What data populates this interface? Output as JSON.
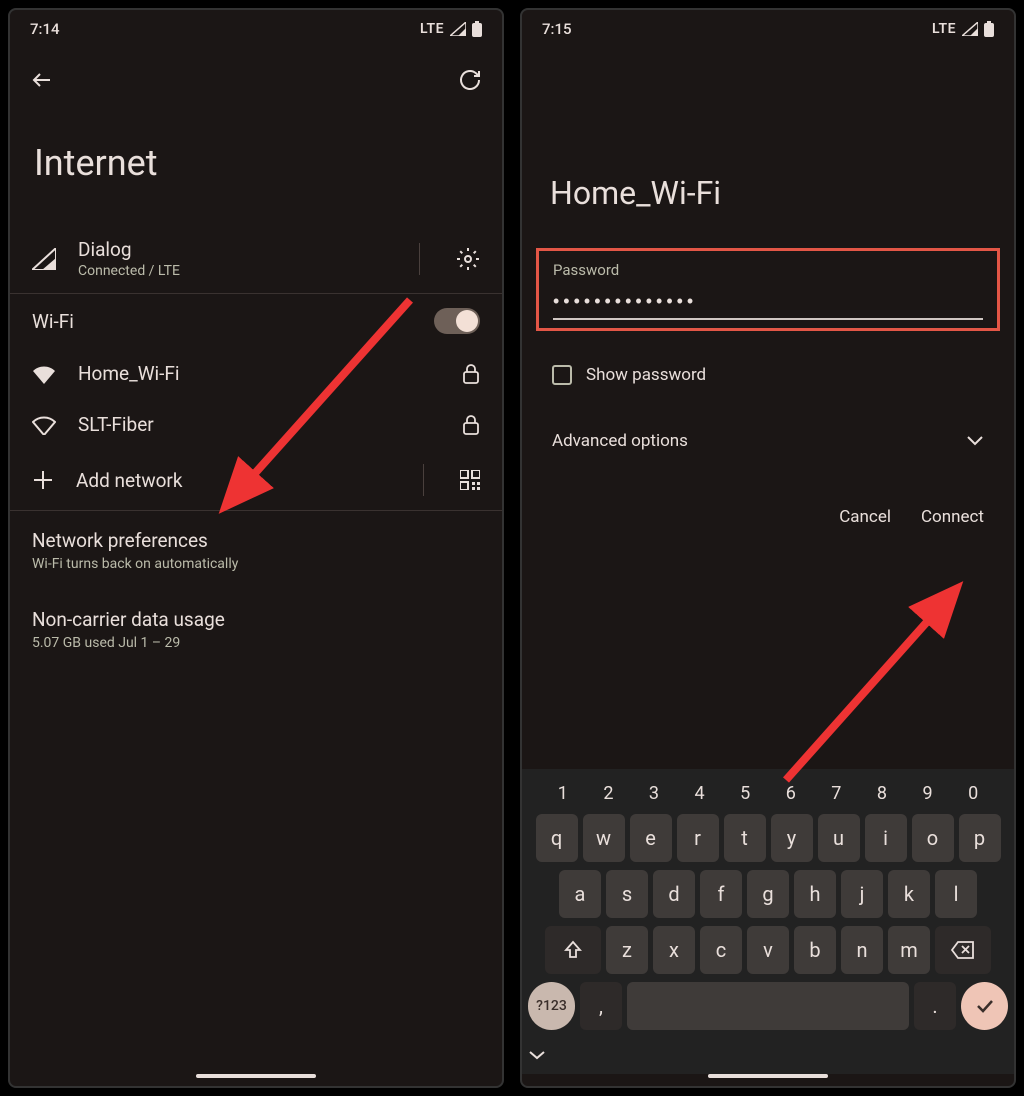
{
  "left": {
    "status": {
      "time": "7:14",
      "net": "LTE"
    },
    "page_title": "Internet",
    "carrier": {
      "name": "Dialog",
      "status": "Connected / LTE"
    },
    "wifi_section": "Wi-Fi",
    "networks": [
      {
        "ssid": "Home_Wi-Fi"
      },
      {
        "ssid": "SLT-Fiber"
      }
    ],
    "add_network": "Add network",
    "prefs": {
      "title": "Network preferences",
      "sub": "Wi-Fi turns back on automatically"
    },
    "usage": {
      "title": "Non-carrier data usage",
      "sub": "5.07 GB used Jul 1 – 29"
    }
  },
  "right": {
    "status": {
      "time": "7:15",
      "net": "LTE"
    },
    "ssid": "Home_Wi-Fi",
    "password_label": "Password",
    "password_value": "••••••••••••••",
    "show_password": "Show password",
    "advanced": "Advanced options",
    "cancel": "Cancel",
    "connect": "Connect",
    "keyboard": {
      "nums": [
        "1",
        "2",
        "3",
        "4",
        "5",
        "6",
        "7",
        "8",
        "9",
        "0"
      ],
      "row1": [
        "q",
        "w",
        "e",
        "r",
        "t",
        "y",
        "u",
        "i",
        "o",
        "p"
      ],
      "row2": [
        "a",
        "s",
        "d",
        "f",
        "g",
        "h",
        "j",
        "k",
        "l"
      ],
      "row3": [
        "z",
        "x",
        "c",
        "v",
        "b",
        "n",
        "m"
      ],
      "sym": "?123",
      "comma": ",",
      "period": "."
    }
  }
}
